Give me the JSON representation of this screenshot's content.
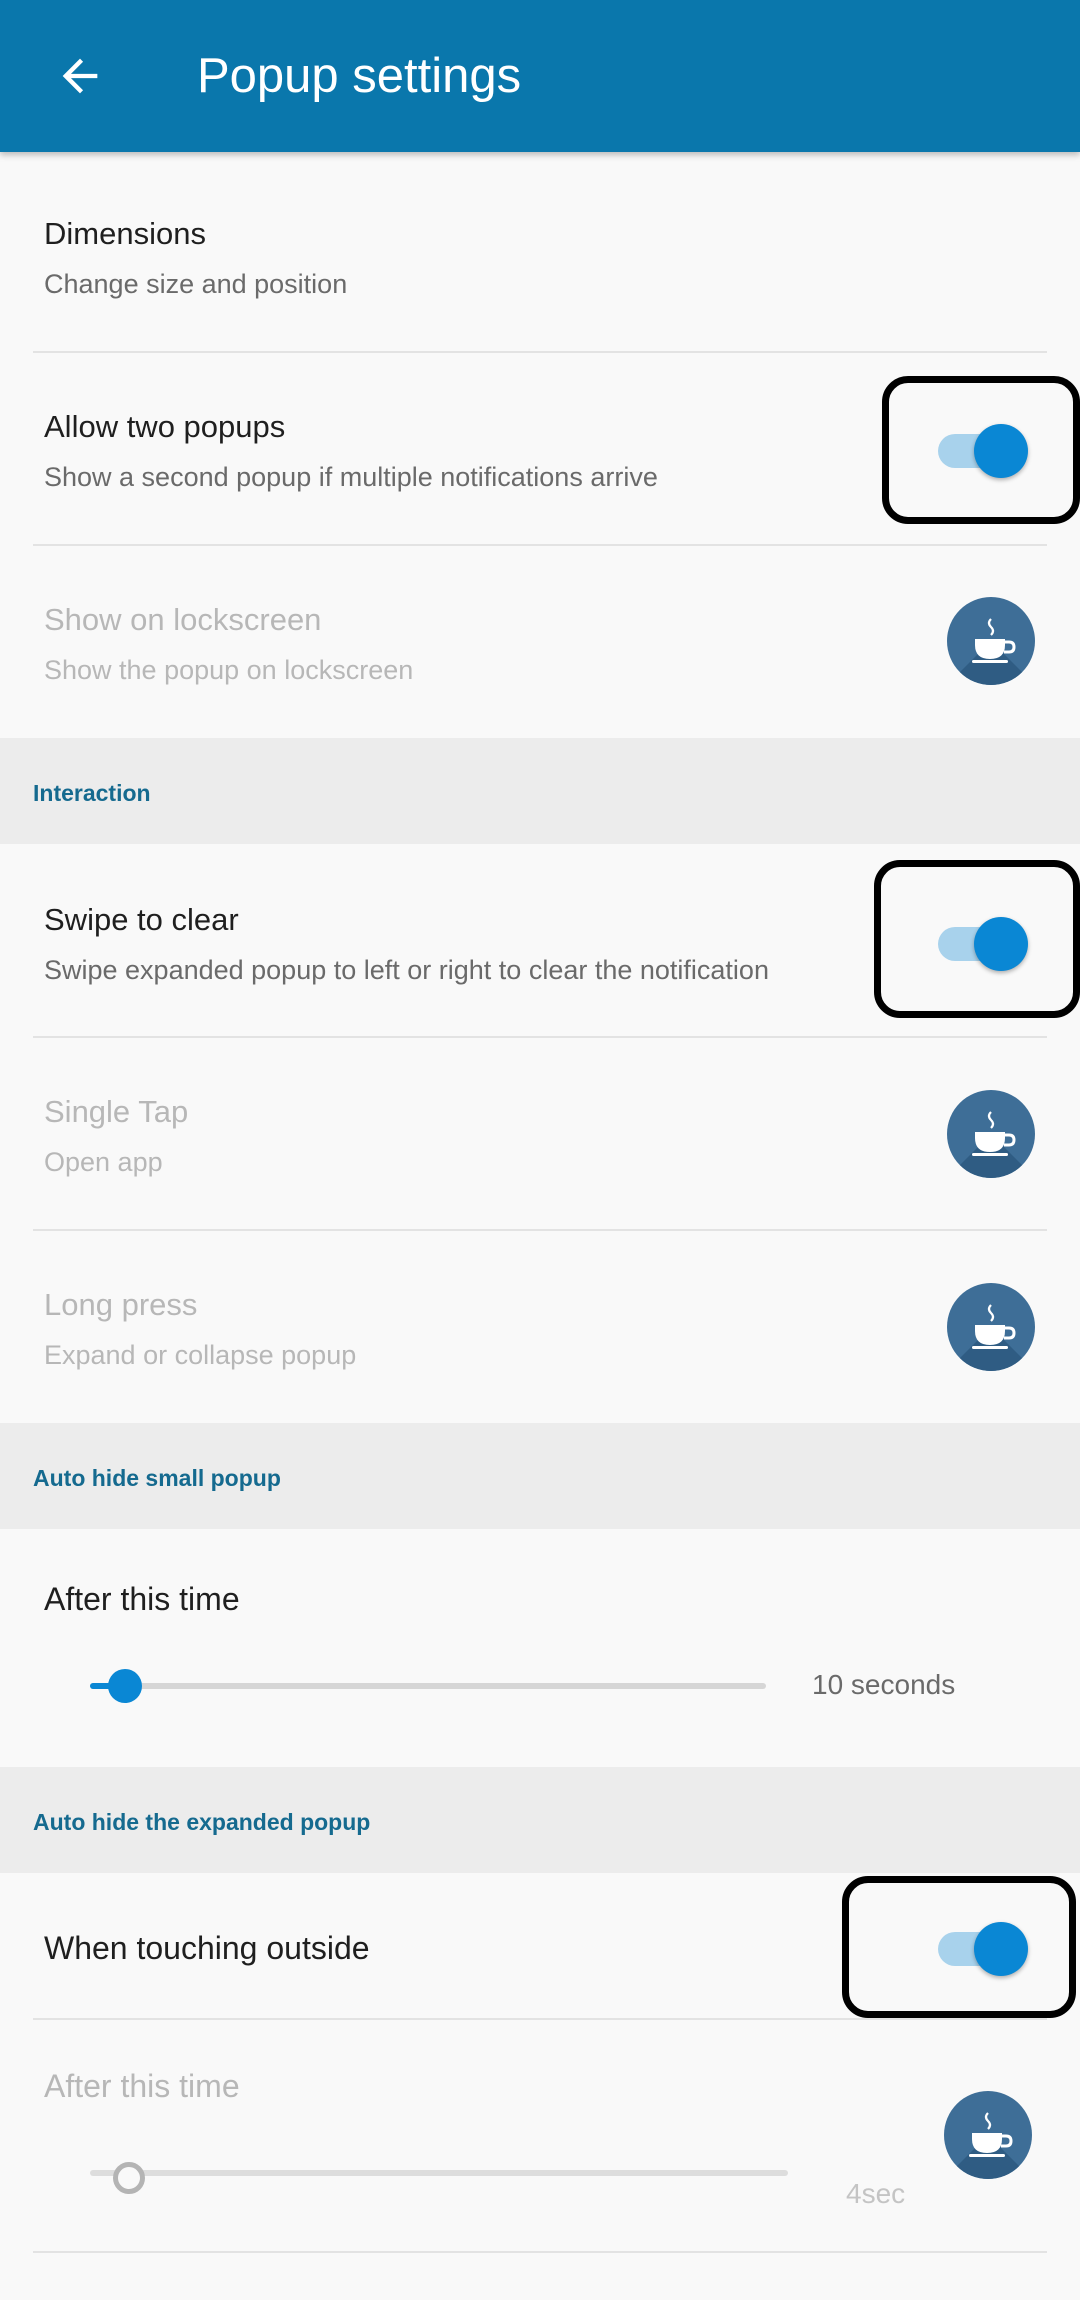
{
  "app_bar": {
    "title": "Popup settings",
    "back_icon": "arrow-left-icon",
    "color": "#0a77ac"
  },
  "general": {
    "dimensions": {
      "title": "Dimensions",
      "subtitle": "Change size and position"
    },
    "allow_two_popups": {
      "title": "Allow two popups",
      "subtitle": "Show a second popup if multiple notifications arrive",
      "on": true
    },
    "show_on_lockscreen": {
      "title": "Show on lockscreen",
      "subtitle": "Show the popup on lockscreen",
      "enabled": false,
      "premium_icon": "coffee-cup-icon"
    }
  },
  "interaction": {
    "header": "Interaction",
    "swipe_to_clear": {
      "title": "Swipe to clear",
      "subtitle": "Swipe expanded popup to left or right to clear the notification",
      "on": true
    },
    "single_tap": {
      "title": "Single Tap",
      "subtitle": "Open app",
      "enabled": false,
      "premium_icon": "coffee-cup-icon"
    },
    "long_press": {
      "title": "Long press",
      "subtitle": "Expand or collapse popup",
      "enabled": false,
      "premium_icon": "coffee-cup-icon"
    }
  },
  "auto_hide_small": {
    "header": "Auto hide small popup",
    "after_time": {
      "title": "After this time",
      "value_label": "10 seconds"
    }
  },
  "auto_hide_expanded": {
    "header": "Auto hide the expanded popup",
    "when_touching_outside": {
      "title": "When touching outside",
      "on": true
    },
    "after_time": {
      "title": "After this time",
      "value_label": "4sec",
      "enabled": false,
      "premium_icon": "coffee-cup-icon"
    }
  },
  "colors": {
    "accent": "#0a87d4",
    "section_header_text": "#156a8f",
    "premium_button": "#3e6e97"
  }
}
